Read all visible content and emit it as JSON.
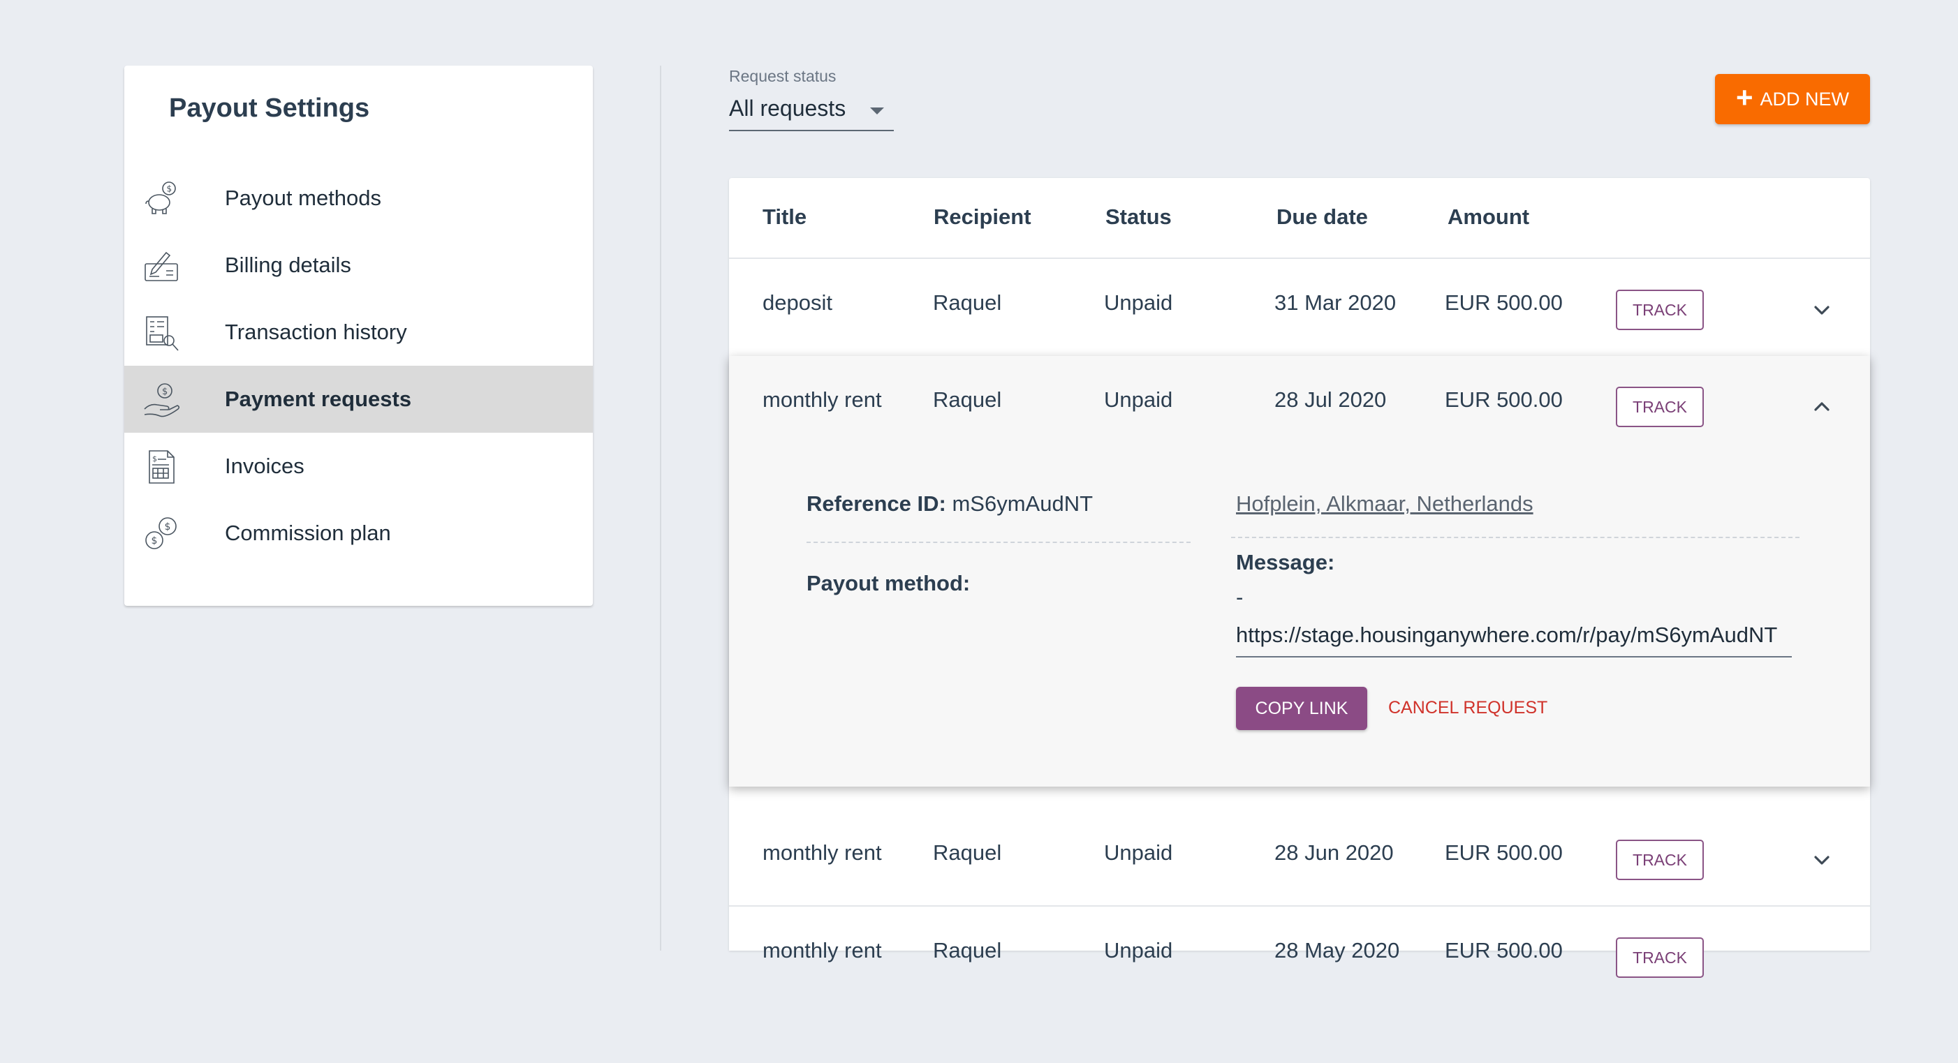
{
  "sidebar": {
    "title": "Payout Settings",
    "items": [
      {
        "label": "Payout methods",
        "icon": "piggy-bank-icon",
        "active": false
      },
      {
        "label": "Billing details",
        "icon": "check-signature-icon",
        "active": false
      },
      {
        "label": "Transaction history",
        "icon": "receipt-magnifier-icon",
        "active": false
      },
      {
        "label": "Payment requests",
        "icon": "hand-coin-icon",
        "active": true
      },
      {
        "label": "Invoices",
        "icon": "invoice-document-icon",
        "active": false
      },
      {
        "label": "Commission plan",
        "icon": "coins-icon",
        "active": false
      }
    ]
  },
  "filter": {
    "label": "Request status",
    "value": "All requests"
  },
  "add_button": {
    "label": "ADD NEW"
  },
  "table": {
    "headers": [
      "Title",
      "Recipient",
      "Status",
      "Due date",
      "Amount"
    ],
    "track_label": "TRACK",
    "rows": [
      {
        "title": "deposit",
        "recipient": "Raquel",
        "status": "Unpaid",
        "due": "31 Mar 2020",
        "amount": "EUR 500.00"
      },
      {
        "title": "monthly rent",
        "recipient": "Raquel",
        "status": "Unpaid",
        "due": "28 Jul 2020",
        "amount": "EUR 500.00"
      },
      {
        "title": "monthly rent",
        "recipient": "Raquel",
        "status": "Unpaid",
        "due": "28 Jun 2020",
        "amount": "EUR 500.00"
      },
      {
        "title": "monthly rent",
        "recipient": "Raquel",
        "status": "Unpaid",
        "due": "28 May 2020",
        "amount": "EUR 500.00"
      }
    ]
  },
  "details": {
    "reference_label": "Reference ID:",
    "reference_value": "mS6ymAudNT",
    "payout_label": "Payout method:",
    "address": "Hofplein, Alkmaar, Netherlands",
    "message_label": "Message:",
    "message_value": "-",
    "link": "https://stage.housinganywhere.com/r/pay/mS6ymAudNT",
    "copy_label": "COPY LINK",
    "cancel_label": "CANCEL REQUEST"
  },
  "colors": {
    "accent_orange": "#f96b00",
    "brand_purple": "#8b4b85",
    "cancel_red": "#d0332b",
    "background": "#eaedf2"
  }
}
